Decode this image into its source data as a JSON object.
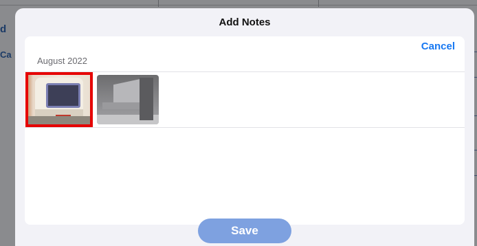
{
  "background": {
    "left_fragments": [
      "d",
      "Ca"
    ]
  },
  "modal": {
    "title": "Add Notes",
    "cancel_label": "Cancel",
    "section_header": "August 2022",
    "save_label": "Save",
    "photos": [
      {
        "name": "instrument-photo",
        "selected": true
      },
      {
        "name": "bracket-photo",
        "selected": false
      }
    ]
  },
  "colors": {
    "accent": "#1778f2",
    "save_button": "#7ea1e0",
    "selection": "#e60000"
  }
}
